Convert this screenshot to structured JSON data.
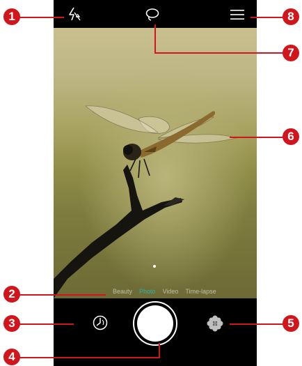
{
  "modes": {
    "items": [
      {
        "label": "Beauty"
      },
      {
        "label": "Photo"
      },
      {
        "label": "Video"
      },
      {
        "label": "Time-lapse"
      }
    ],
    "active": "Photo"
  },
  "icons": {
    "flash": "flash-off-icon",
    "filter": "lasso-filter-icon",
    "menu": "menu-icon",
    "timer": "timer-icon",
    "shutter": "shutter-button",
    "gallery": "gallery-flower-icon"
  },
  "callouts": [
    "1",
    "2",
    "3",
    "4",
    "5",
    "6",
    "7",
    "8"
  ],
  "colors": {
    "callout": "#d0161c",
    "active_mode": "#2bb3a0"
  }
}
